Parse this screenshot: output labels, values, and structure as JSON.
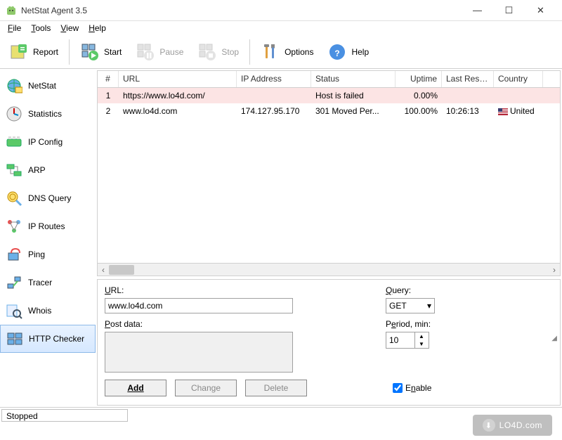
{
  "window": {
    "title": "NetStat Agent 3.5"
  },
  "menu": {
    "file": "File",
    "tools": "Tools",
    "view": "View",
    "help": "Help"
  },
  "toolbar": {
    "report": "Report",
    "start": "Start",
    "pause": "Pause",
    "stop": "Stop",
    "options": "Options",
    "help": "Help"
  },
  "sidebar": {
    "items": [
      {
        "label": "NetStat"
      },
      {
        "label": "Statistics"
      },
      {
        "label": "IP Config"
      },
      {
        "label": "ARP"
      },
      {
        "label": "DNS Query"
      },
      {
        "label": "IP Routes"
      },
      {
        "label": "Ping"
      },
      {
        "label": "Tracer"
      },
      {
        "label": "Whois"
      },
      {
        "label": "HTTP Checker"
      }
    ],
    "selected_index": 9
  },
  "table": {
    "columns": {
      "num": "#",
      "url": "URL",
      "ip": "IP Address",
      "status": "Status",
      "uptime": "Uptime",
      "last_resp": "Last Resp...",
      "country": "Country"
    },
    "rows": [
      {
        "num": "1",
        "url": "https://www.lo4d.com/",
        "ip": "",
        "status": "Host is failed",
        "uptime": "0.00%",
        "last_resp": "",
        "country": "",
        "failed": true
      },
      {
        "num": "2",
        "url": "www.lo4d.com",
        "ip": "174.127.95.170",
        "status": "301 Moved Per...",
        "uptime": "100.00%",
        "last_resp": "10:26:13",
        "country": "United",
        "failed": false,
        "flag": "us"
      }
    ]
  },
  "form": {
    "url_label": "URL:",
    "url_value": "www.lo4d.com",
    "post_label": "Post data:",
    "post_value": "",
    "query_label": "Query:",
    "query_value": "GET",
    "period_label": "Period, min:",
    "period_value": "10",
    "add": "Add",
    "change": "Change",
    "delete": "Delete",
    "enable_label": "Enable",
    "enable_checked": true
  },
  "status": {
    "text": "Stopped"
  },
  "watermark": "LO4D.com"
}
